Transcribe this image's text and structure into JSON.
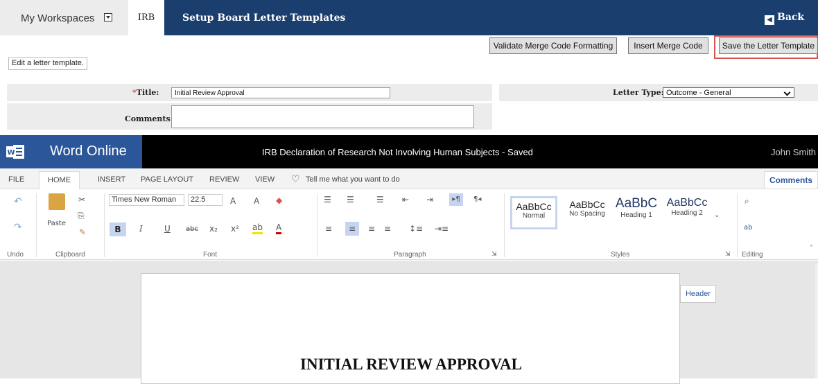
{
  "nav": {
    "workspaces": "My Workspaces",
    "irb_tab": "IRB",
    "title": "Setup Board Letter Templates",
    "back": "Back"
  },
  "toolbar": {
    "validate": "Validate Merge Code Formatting",
    "insert": "Insert Merge Code",
    "save": "Save the Letter Template"
  },
  "hint": "Edit a letter template.",
  "form": {
    "title_required_mark": "*",
    "title_label": "Title:",
    "title_value": "Initial Review Approval",
    "letter_type_label": "Letter Type:",
    "letter_type_value": "Outcome - General",
    "comments_label": "Comments:",
    "comments_value": ""
  },
  "word": {
    "app_name": "Word Online",
    "document_title": "IRB Declaration of Research Not Involving Human Subjects   -   Saved",
    "user": "John Smith",
    "tabs": [
      "FILE",
      "HOME",
      "INSERT",
      "PAGE LAYOUT",
      "REVIEW",
      "VIEW"
    ],
    "tell_me": "Tell me what you want to do",
    "comments_button": "Comments",
    "ribbon": {
      "undo_group": "Undo",
      "clipboard_group": "Clipboard",
      "paste": "Paste",
      "font_group": "Font",
      "font_name": "Times New Roman",
      "font_size": "22.5",
      "paragraph_group": "Paragraph",
      "styles_group": "Styles",
      "editing_group": "Editing",
      "styles": [
        {
          "preview": "AaBbCc",
          "name": "Normal"
        },
        {
          "preview": "AaBbCc",
          "name": "No Spacing"
        },
        {
          "preview": "AaBbC",
          "name": "Heading 1"
        },
        {
          "preview": "AaBbCc",
          "name": "Heading 2"
        }
      ]
    },
    "header_button": "Header",
    "page_heading": "INITIAL REVIEW APPROVAL"
  },
  "colors": {
    "nav_blue": "#1a3e6e",
    "word_blue": "#2b579a",
    "highlight_red": "#d9534f"
  }
}
